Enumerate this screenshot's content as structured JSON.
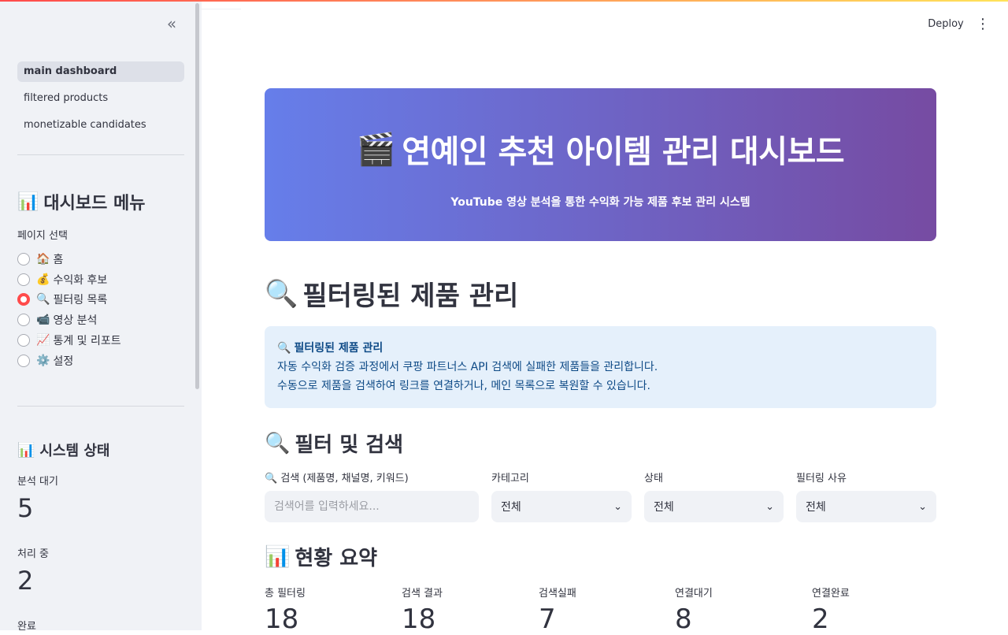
{
  "header": {
    "deploy_label": "Deploy",
    "menu_icon": "kebab-icon"
  },
  "sidebar": {
    "collapse_icon": "double-chevron-left-icon",
    "nav": [
      {
        "label": "main dashboard",
        "active": true
      },
      {
        "label": "filtered products",
        "active": false
      },
      {
        "label": "monetizable candidates",
        "active": false
      }
    ],
    "menu_heading": {
      "emoji": "📊",
      "text": "대시보드 메뉴"
    },
    "page_select_label": "페이지 선택",
    "pages": [
      {
        "emoji": "🏠",
        "label": "홈",
        "selected": false
      },
      {
        "emoji": "💰",
        "label": "수익화 후보",
        "selected": false
      },
      {
        "emoji": "🔍",
        "label": "필터링 목록",
        "selected": true
      },
      {
        "emoji": "📹",
        "label": "영상 분석",
        "selected": false
      },
      {
        "emoji": "📈",
        "label": "통계 및 리포트",
        "selected": false
      },
      {
        "emoji": "⚙️",
        "label": "설정",
        "selected": false
      }
    ],
    "status_heading": {
      "emoji": "📊",
      "text": "시스템 상태"
    },
    "metrics": [
      {
        "label": "분석 대기",
        "value": "5"
      },
      {
        "label": "처리 중",
        "value": "2"
      },
      {
        "label": "완료",
        "value": ""
      }
    ]
  },
  "banner": {
    "emoji": "🎬",
    "title": "연예인 추천 아이템 관리 대시보드",
    "subtitle": "YouTube 영상 분석을 통한 수익화 가능 제품 후보 관리 시스템"
  },
  "main": {
    "heading": {
      "emoji": "🔍",
      "text": "필터링된 제품 관리"
    },
    "info": {
      "emoji": "🔍",
      "title": "필터링된 제품 관리",
      "line1": "자동 수익화 검증 과정에서 쿠팡 파트너스 API 검색에 실패한 제품들을 관리합니다.",
      "line2": "수동으로 제품을 검색하여 링크를 연결하거나, 메인 목록으로 복원할 수 있습니다."
    },
    "filter_heading": {
      "emoji": "🔍",
      "text": "필터 및 검색"
    },
    "filters": {
      "search_label": "🔍 검색 (제품명, 채널명, 키워드)",
      "search_placeholder": "검색어를 입력하세요...",
      "search_value": "",
      "category_label": "카테고리",
      "category_value": "전체",
      "status_label": "상태",
      "status_value": "전체",
      "reason_label": "필터링 사유",
      "reason_value": "전체"
    },
    "summary_heading": {
      "emoji": "📊",
      "text": "현황 요약"
    },
    "summary": [
      {
        "label": "총 필터링",
        "value": "18"
      },
      {
        "label": "검색 결과",
        "value": "18"
      },
      {
        "label": "검색실패",
        "value": "7"
      },
      {
        "label": "연결대기",
        "value": "8"
      },
      {
        "label": "연결완료",
        "value": "2"
      }
    ]
  },
  "colors": {
    "accent": "#ff4b4b",
    "banner_start": "#667eea",
    "banner_end": "#764ba2",
    "info_bg": "#e5f0fb",
    "info_text": "#0e4a86",
    "sidebar_bg": "#f0f2f6"
  }
}
